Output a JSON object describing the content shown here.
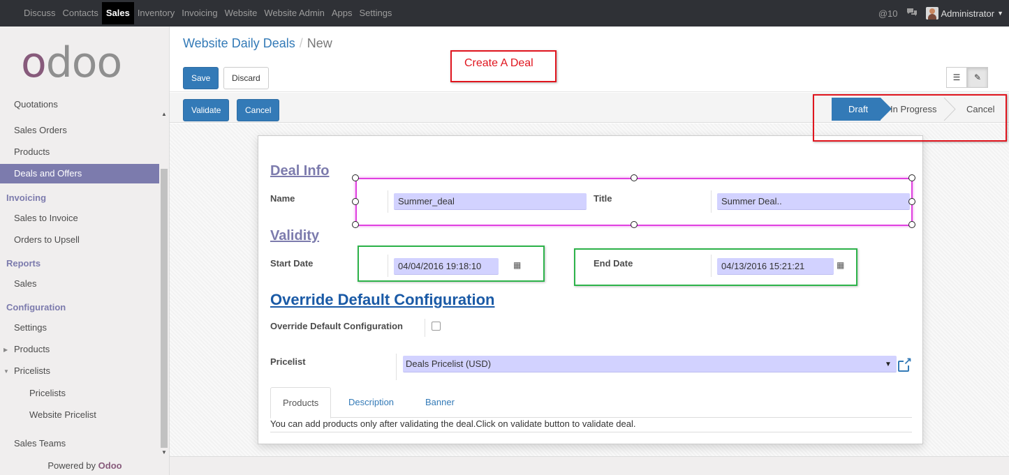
{
  "topbar": {
    "menu": [
      "Discuss",
      "Contacts",
      "Sales",
      "Inventory",
      "Invoicing",
      "Website",
      "Website Admin",
      "Apps",
      "Settings"
    ],
    "active_menu": "Sales",
    "mentions": "@10",
    "user": "Administrator"
  },
  "sidebar": {
    "logo": {
      "part1": "o",
      "part2": "doo"
    },
    "items": {
      "quotations": "Quotations",
      "sales_orders": "Sales Orders",
      "products": "Products",
      "deals": "Deals and Offers",
      "invoicing_header": "Invoicing",
      "sales_to_invoice": "Sales to Invoice",
      "orders_to_upsell": "Orders to Upsell",
      "reports_header": "Reports",
      "sales": "Sales",
      "config_header": "Configuration",
      "settings": "Settings",
      "cfg_products": "Products",
      "pricelists_parent": "Pricelists",
      "pricelists": "Pricelists",
      "website_pricelist": "Website Pricelist",
      "sales_teams": "Sales Teams"
    },
    "powered_prefix": "Powered by",
    "powered_brand": "Odoo"
  },
  "control": {
    "breadcrumb_parent": "Website Daily Deals",
    "breadcrumb_sep": "/",
    "breadcrumb_current": "New",
    "save": "Save",
    "discard": "Discard",
    "annotation": "Create A Deal"
  },
  "statusbar": {
    "validate": "Validate",
    "cancel": "Cancel",
    "stages": [
      "Draft",
      "In Progress",
      "Cancel"
    ],
    "current_stage": "Draft"
  },
  "form": {
    "deal_info_title": "Deal Info",
    "name_label": "Name",
    "name_value": "Summer_deal",
    "title_label": "Title",
    "title_value": "Summer Deal..",
    "validity_title": "Validity",
    "start_label": "Start Date",
    "start_value": "04/04/2016 19:18:10",
    "end_label": "End Date",
    "end_value": "04/13/2016 15:21:21",
    "override_title": "Override Default Configuration",
    "override_label": "Override Default Configuration",
    "override_checked": false,
    "pricelist_label": "Pricelist",
    "pricelist_value": "Deals Pricelist (USD)",
    "tabs": [
      "Products",
      "Description",
      "Banner"
    ],
    "active_tab": "Products",
    "products_note": "You can add products only after validating the deal.Click on validate button to validate deal."
  },
  "colors": {
    "brand": "#875a7b",
    "primary": "#337ab7",
    "annotation_red": "#e0151e",
    "annotation_green": "#2db34a",
    "annotation_pink": "#e040e0"
  }
}
